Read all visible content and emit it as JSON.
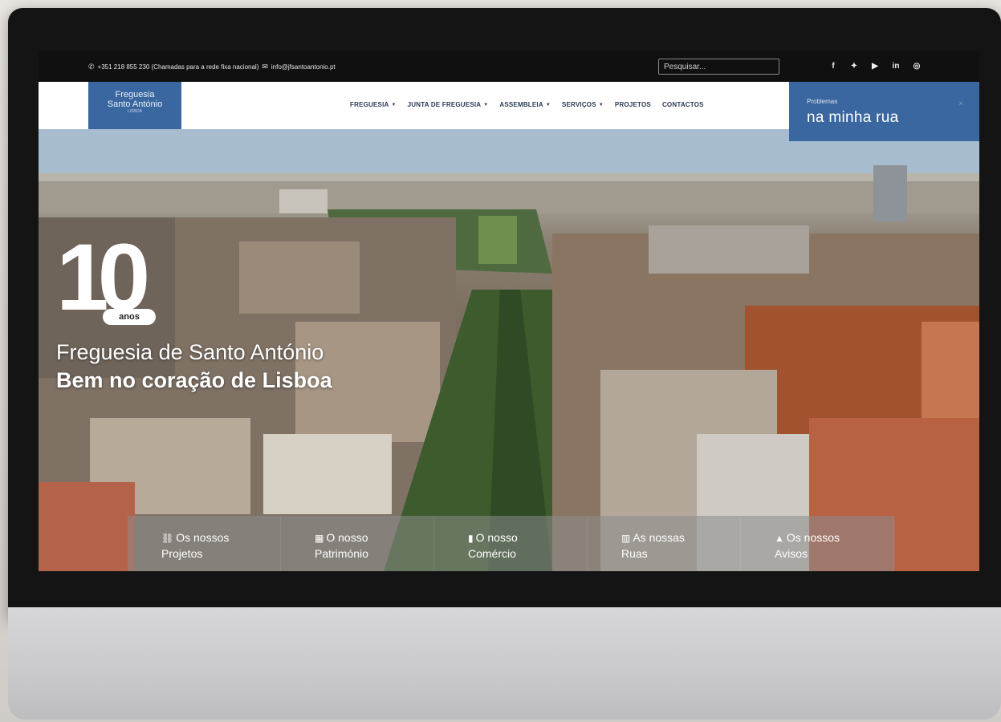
{
  "topbar": {
    "phone": "+351 218 855 230 (Chamadas para a rede fixa nacional)",
    "email": "info@jfsantoantonio.pt",
    "search_placeholder": "Pesquisar..."
  },
  "social": [
    "facebook-icon",
    "twitter-icon",
    "youtube-icon",
    "linkedin-icon",
    "instagram-icon"
  ],
  "logo": {
    "line1": "Freguesia",
    "line2": "Santo António",
    "line3": "LISBOA"
  },
  "menu": [
    {
      "label": "FREGUESIA",
      "dropdown": true
    },
    {
      "label": "JUNTA DE FREGUESIA",
      "dropdown": true
    },
    {
      "label": "ASSEMBLEIA",
      "dropdown": true
    },
    {
      "label": "SERVIÇOS",
      "dropdown": true
    },
    {
      "label": "PROJETOS",
      "dropdown": false
    },
    {
      "label": "CONTACTOS",
      "dropdown": false
    }
  ],
  "promo": {
    "small": "Problemas",
    "big": "na minha rua",
    "close": "×"
  },
  "hero": {
    "ten": "10",
    "anos": "anos",
    "title": "Freguesia de Santo António",
    "subtitle": "Bem no coração de Lisboa"
  },
  "cards": [
    {
      "icon": "⛓",
      "line1": "Os nossos",
      "line2": "Projetos"
    },
    {
      "icon": "▦",
      "line1": "O nosso",
      "line2": "Património"
    },
    {
      "icon": "▮",
      "line1": "O nosso",
      "line2": "Comércio"
    },
    {
      "icon": "▥",
      "line1": "As nossas",
      "line2": "Ruas"
    },
    {
      "icon": "▲",
      "line1": "Os nossos",
      "line2": "Avisos"
    }
  ],
  "accessibility_icon": "♿"
}
